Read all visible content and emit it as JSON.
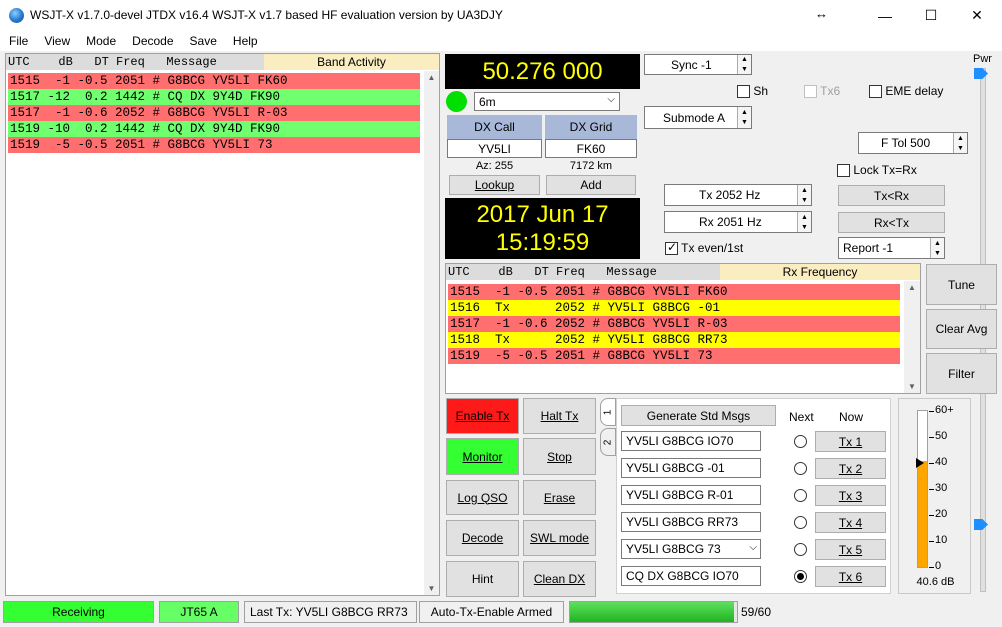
{
  "title": "WSJT-X   v1.7.0-devel   JTDX v16.4    WSJT-X v1.7 based HF evaluation version by UA3DJY",
  "window_controls": {
    "resize": "↔",
    "minimize": "—",
    "maximize": "☐",
    "close": "✕"
  },
  "menu": [
    "File",
    "View",
    "Mode",
    "Decode",
    "Save",
    "Help"
  ],
  "band_activity": {
    "header": "UTC    dB   DT Freq   Message",
    "label": "Band Activity",
    "rows": [
      {
        "text": "1515  -1 -0.5 2051 # G8BCG YV5LI FK60",
        "color": "red"
      },
      {
        "text": "1517 -12  0.2 1442 # CQ DX 9Y4D FK90",
        "color": "green"
      },
      {
        "text": "1517  -1 -0.6 2052 # G8BCG YV5LI R-03",
        "color": "red"
      },
      {
        "text": "1519 -10  0.2 1442 # CQ DX 9Y4D FK90",
        "color": "green"
      },
      {
        "text": "1519  -5 -0.5 2051 # G8BCG YV5LI 73",
        "color": "red"
      }
    ]
  },
  "dial_freq": "50.276 000",
  "band": "6m",
  "dx_call_label": "DX Call",
  "dx_grid_label": "DX Grid",
  "dx_call": "YV5LI",
  "dx_grid": "FK60",
  "azimuth": "Az: 255",
  "distance": "7172 km",
  "lookup_label": "Lookup",
  "add_label": "Add",
  "date": "2017 Jun 17",
  "time": "15:19:59",
  "sync": "Sync   -1",
  "sh_label": "Sh",
  "tx6_label": "Tx6",
  "eme_label": "EME delay",
  "submode": "Submode A",
  "ftol": "F Tol  500",
  "lock_label": "Lock Tx=Rx",
  "tx_freq": "Tx  2052  Hz",
  "rx_freq": "Rx  2051  Hz",
  "tx_lt_rx": "Tx<Rx",
  "rx_lt_tx": "Rx<Tx",
  "tx_even_label": "Tx even/1st",
  "report": "Report -1",
  "pwr_label": "Pwr",
  "rx_frequency": {
    "header": "UTC    dB   DT Freq   Message",
    "label": "Rx Frequency",
    "rows": [
      {
        "text": "1515  -1 -0.5 2051 # G8BCG YV5LI FK60",
        "color": "red"
      },
      {
        "text": "1516  Tx      2052 # YV5LI G8BCG -01",
        "color": "yellow"
      },
      {
        "text": "1517  -1 -0.6 2052 # G8BCG YV5LI R-03",
        "color": "red"
      },
      {
        "text": "1518  Tx      2052 # YV5LI G8BCG RR73",
        "color": "yellow"
      },
      {
        "text": "1519  -5 -0.5 2051 # G8BCG YV5LI 73",
        "color": "red"
      }
    ]
  },
  "tune_label": "Tune",
  "clear_avg_label": "Clear Avg",
  "filter_label": "Filter",
  "buttons": {
    "enable_tx": "Enable Tx",
    "halt_tx": "Halt Tx",
    "monitor": "Monitor",
    "stop": "Stop",
    "log_qso": "Log QSO",
    "erase": "Erase",
    "decode": "Decode",
    "swl_mode": "SWL mode",
    "hint": "Hint",
    "clean_dx": "Clean DX"
  },
  "tabs": [
    "1",
    "2"
  ],
  "gen_std_msgs": "Generate Std Msgs",
  "next_label": "Next",
  "now_label": "Now",
  "messages": [
    {
      "text": "YV5LI G8BCG IO70",
      "tx": "Tx 1",
      "selected": false
    },
    {
      "text": "YV5LI G8BCG -01",
      "tx": "Tx 2",
      "selected": false
    },
    {
      "text": "YV5LI G8BCG R-01",
      "tx": "Tx 3",
      "selected": false
    },
    {
      "text": "YV5LI G8BCG RR73",
      "tx": "Tx 4",
      "selected": false
    },
    {
      "text": "YV5LI G8BCG 73",
      "tx": "Tx 5",
      "selected": false
    },
    {
      "text": "CQ DX G8BCG IO70",
      "tx": "Tx 6",
      "selected": true
    }
  ],
  "meter": {
    "ticks": [
      "60+",
      "50",
      "40",
      "30",
      "20",
      "10",
      "0"
    ],
    "level_db": 40.6,
    "marker_db": 40,
    "reading": "40.6 dB",
    "bar_color": "#ffa500"
  },
  "status": {
    "receiving": "Receiving",
    "mode": "JT65 A",
    "last_tx": "Last Tx:  YV5LI G8BCG RR73",
    "auto_tx": "Auto-Tx-Enable Armed",
    "progress_fraction": 0.983,
    "counter": "59/60"
  },
  "colors": {
    "red_row": "#ff6f6f",
    "green_row": "#6fff6f",
    "yellow_row": "#ffff00",
    "enable_tx": "#ff1a1a",
    "monitor": "#33ff33",
    "status_green": "#33ff33",
    "dx_header": "#a8b8d8"
  }
}
